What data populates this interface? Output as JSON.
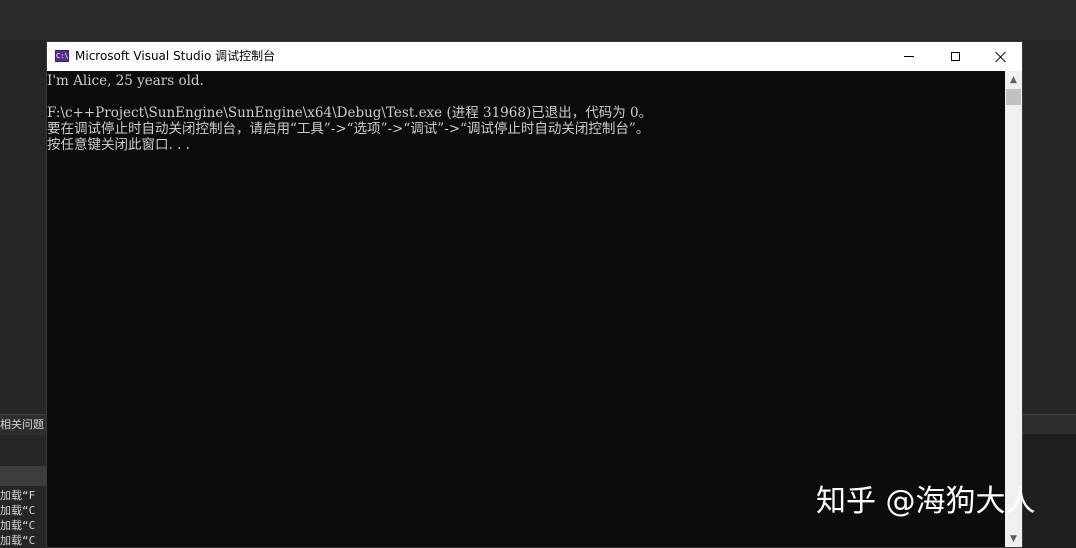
{
  "ide": {
    "panel_title": "相关问题",
    "output_lines": [
      "加载“F",
      "加载“C",
      "加载“C",
      "加载“C"
    ]
  },
  "console_window": {
    "title": "Microsoft Visual Studio 调试控制台",
    "icon": "visual-studio-console-icon",
    "lines": [
      "I'm Alice, 25 years old.",
      "",
      "F:\\c++Project\\SunEngine\\SunEngine\\x64\\Debug\\Test.exe (进程 31968)已退出，代码为 0。",
      "要在调试停止时自动关闭控制台，请启用“工具”->“选项”->“调试”->“调试停止时自动关闭控制台”。",
      "按任意键关闭此窗口. . ."
    ],
    "controls": {
      "minimize": "minimize-icon",
      "maximize": "maximize-icon",
      "close": "close-icon"
    }
  },
  "watermark": "知乎 @海狗大人",
  "colors": {
    "console_bg": "#0c0c0c",
    "console_text": "#cccccc",
    "titlebar_bg": "#ffffff",
    "ide_bg": "#252526"
  }
}
